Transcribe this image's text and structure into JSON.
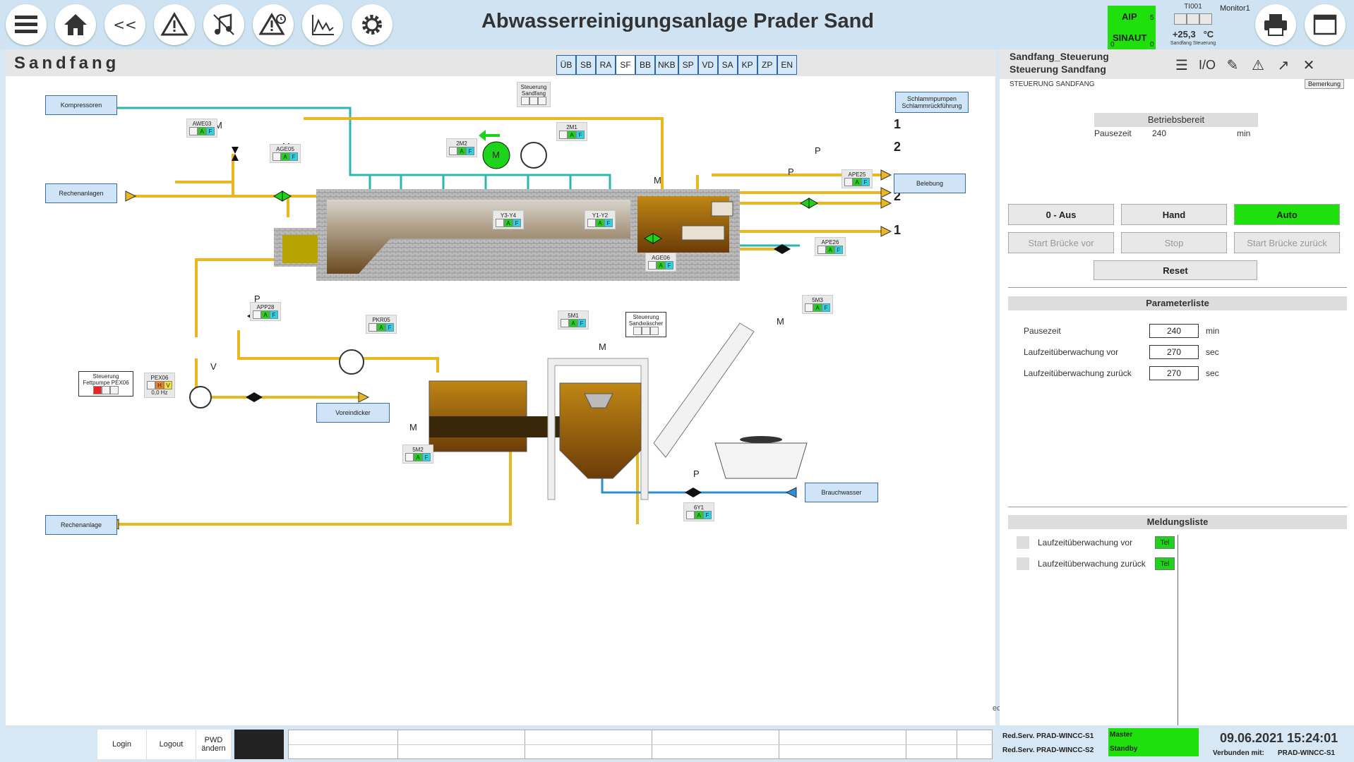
{
  "header": {
    "title": "Abwasserreinigungsanlage Prader Sand",
    "aip": {
      "line1": "AIP",
      "line2": "SINAUT",
      "n1": "5",
      "n2": "0",
      "n3": "0"
    },
    "ti": {
      "label": "TI001",
      "value": "+25,3",
      "unit": "°C",
      "sub1": "Sandfang",
      "sub2": "Steuerung"
    },
    "monitor": "Monitor1"
  },
  "section": {
    "title": "Sandfang",
    "tabs": [
      "ÜB",
      "SB",
      "RA",
      "SF",
      "BB",
      "NKB",
      "SP",
      "VD",
      "SA",
      "KP",
      "ZP",
      "EN"
    ],
    "active_tab": "SF"
  },
  "diagram": {
    "boxes": {
      "kompressoren": "Kompressoren",
      "rechenanlagen": "Rechenanlagen",
      "rechenanlage": "Rechenanlage",
      "schlamm": "Schlammpumpen Schlammrückführung",
      "belebung": "Belebung",
      "voreindicker": "Voreindicker",
      "brauchwasser": "Brauchwasser",
      "steuerung_sf": "Steuerung Sandfang",
      "steuerung_sw": "Steuerung Sandwäscher",
      "steuerung_fp": "Steuerung Fettpumpe PEX06"
    },
    "tags": {
      "awe03": "AWE03",
      "age05": "AGE05",
      "m2m2": "2M2",
      "m2m1": "2M1",
      "y3y4": "Y3-Y4",
      "y1y2": "Y1-Y2",
      "age06": "AGE06",
      "ape25": "APE25",
      "ape26": "APE26",
      "app28": "APP28",
      "pkr05": "PKR05",
      "m5m1": "5M1",
      "m5m3": "5M3",
      "m5m2": "5M2",
      "v6y1": "6Y1",
      "pex06": "PEX06"
    },
    "pex_value": "0,0",
    "pex_unit": "Hz",
    "line_1": "1",
    "line_2": "2",
    "letter_a": "A",
    "letter_f": "F",
    "letter_h": "H",
    "letter_v": "V",
    "sym_m": "M",
    "sym_p": "P",
    "sym_v": "V"
  },
  "panel": {
    "title1": "Sandfang_Steuerung",
    "title2": "Steuerung Sandfang",
    "io": "I/O",
    "sub": "STEUERUNG SANDFANG",
    "bemerkung": "Bemerkung",
    "status": "Betriebsbereit",
    "pause_label": "Pausezeit",
    "pause_value": "240",
    "pause_unit": "min",
    "buttons": {
      "aus": "0 - Aus",
      "hand": "Hand",
      "auto": "Auto",
      "vor": "Start Brücke vor",
      "stop": "Stop",
      "zurueck": "Start Brücke zurück",
      "reset": "Reset"
    },
    "param_header": "Parameterliste",
    "params": [
      {
        "label": "Pausezeit",
        "value": "240",
        "unit": "min"
      },
      {
        "label": "Laufzeitüberwachung vor",
        "value": "270",
        "unit": "sec"
      },
      {
        "label": "Laufzeitüberwachung zurück",
        "value": "270",
        "unit": "sec"
      }
    ],
    "msg_header": "Meldungsliste",
    "messages": [
      {
        "label": "Laufzeitüberwachung vor",
        "badge": "Tel"
      },
      {
        "label": "Laufzeitüberwachung zurück",
        "badge": "Tel"
      }
    ]
  },
  "footer": {
    "login": "Login",
    "logout": "Logout",
    "pwd": "PWD ändern",
    "srv1": "Red.Serv. PRAD-WINCC-S1",
    "srv2": "Red.Serv. PRAD-WINCC-S2",
    "master": "Master",
    "standby": "Standby",
    "datetime": "09.06.2021 15:24:01",
    "verbunden_label": "Verbunden mit:",
    "verbunden_value": "PRAD-WINCC-S1",
    "ec": "ec"
  }
}
